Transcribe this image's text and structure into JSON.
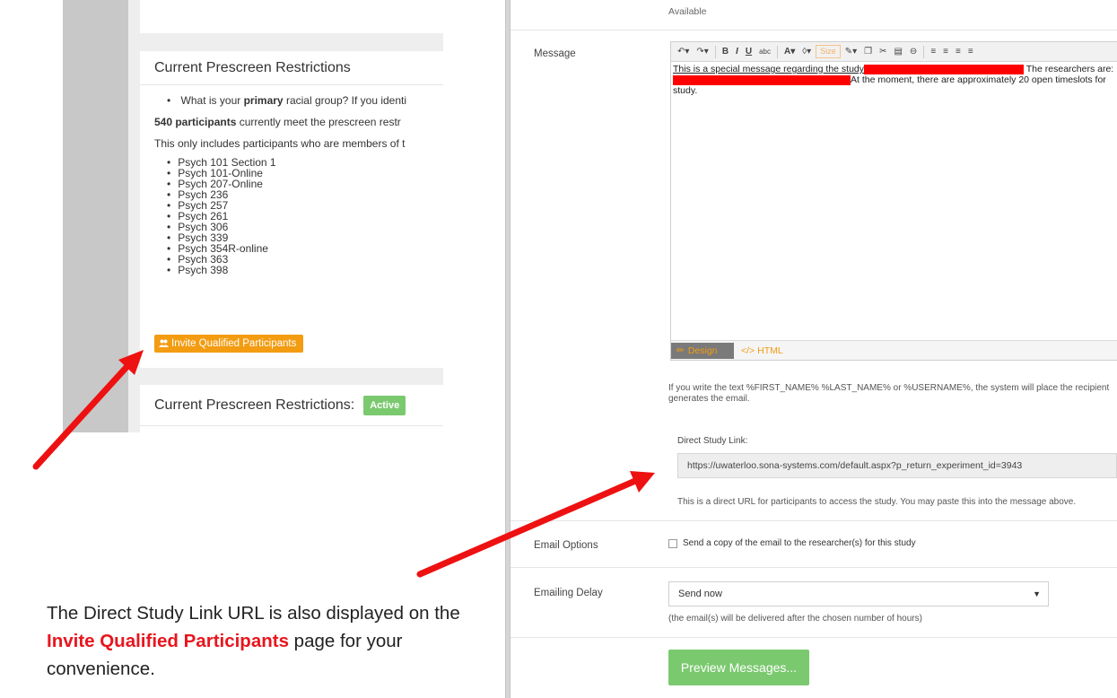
{
  "left": {
    "card2_title": "Current Prescreen Restrictions",
    "question_bullet_start": "What is your ",
    "question_bullet_bold": "primary",
    "question_bullet_end": " racial group? If you identi",
    "count_bold": "540 participants",
    "count_rest": " currently meet the prescreen restr",
    "members_text": "This only includes participants who are members of t",
    "courses": [
      "Psych 101 Section 1",
      "Psych 101-Online",
      "Psych 207-Online",
      "Psych 236",
      "Psych 257",
      "Psych 261",
      "Psych 306",
      "Psych 339",
      "Psych 354R-online",
      "Psych 363",
      "Psych 398"
    ],
    "invite_button": "Invite Qualified Participants",
    "card3_title": "Current Prescreen Restrictions:",
    "active_badge": "Active"
  },
  "right": {
    "available": "Available",
    "message_label": "Message",
    "editor_line1_start": "This is a special message regarding the study",
    "editor_line1_end": " The researchers are:",
    "editor_line2_end": "At the moment, there are approximately 20 open timeslots for",
    "editor_line3": "study.",
    "toolbar_size": "Size",
    "design_tab": "Design",
    "html_tab": "HTML",
    "note": "If you write the text %FIRST_NAME% %LAST_NAME% or %USERNAME%, the system will place the recipient generates the email.",
    "direct_link_label": "Direct Study Link:",
    "direct_link_url": "https://uwaterloo.sona-systems.com/default.aspx?p_return_experiment_id=3943",
    "direct_link_help": "This is a direct URL for participants to access the study. You may paste this into the message above.",
    "email_options_label": "Email Options",
    "email_options_text": "Send a copy of the email to the researcher(s) for this study",
    "emailing_delay_label": "Emailing Delay",
    "delay_selected": "Send now",
    "delay_help": "(the email(s) will be delivered after the chosen number of hours)",
    "preview_button": "Preview Messages..."
  },
  "caption": {
    "part1": "The Direct Study Link URL is also displayed on the ",
    "highlight": "Invite Qualified Participants",
    "part2": " page for your convenience."
  },
  "colors": {
    "accent_orange": "#f39c12",
    "success_green": "#7bc96f",
    "arrow_red": "#ee1111",
    "redaction": "#ff0000"
  }
}
